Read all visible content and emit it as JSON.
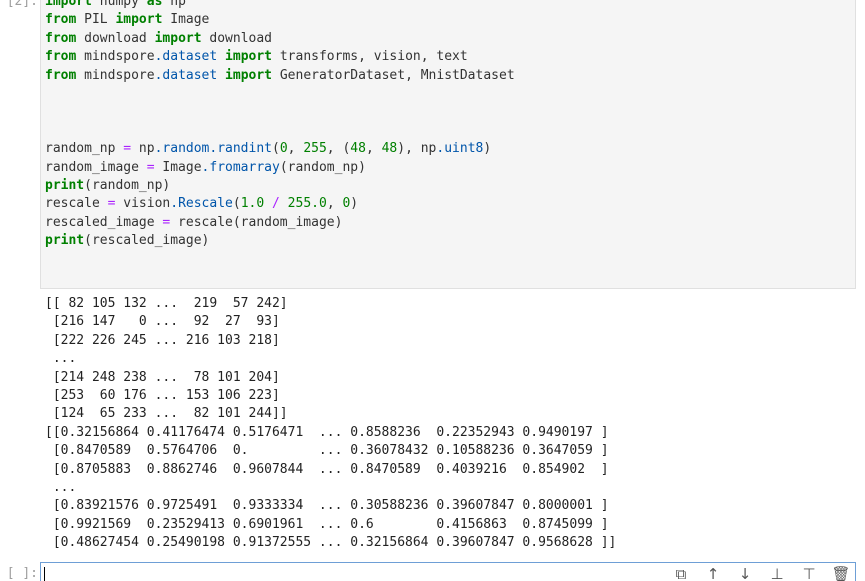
{
  "cell_top": {
    "prompt": "[2]:",
    "code_lines": [
      [
        {
          "t": "kw",
          "v": "import"
        },
        {
          "t": "p",
          "v": " numpy "
        },
        {
          "t": "kw",
          "v": "as"
        },
        {
          "t": "p",
          "v": " np"
        }
      ],
      [
        {
          "t": "kw",
          "v": "from"
        },
        {
          "t": "p",
          "v": " PIL "
        },
        {
          "t": "kw",
          "v": "import"
        },
        {
          "t": "p",
          "v": " Image"
        }
      ],
      [
        {
          "t": "kw",
          "v": "from"
        },
        {
          "t": "p",
          "v": " download "
        },
        {
          "t": "kw",
          "v": "import"
        },
        {
          "t": "p",
          "v": " download"
        }
      ],
      [
        {
          "t": "kw",
          "v": "from"
        },
        {
          "t": "p",
          "v": " mindspore"
        },
        {
          "t": "attr",
          "v": ".dataset"
        },
        {
          "t": "p",
          "v": " "
        },
        {
          "t": "kw",
          "v": "import"
        },
        {
          "t": "p",
          "v": " transforms, vision, text"
        }
      ],
      [
        {
          "t": "kw",
          "v": "from"
        },
        {
          "t": "p",
          "v": " mindspore"
        },
        {
          "t": "attr",
          "v": ".dataset"
        },
        {
          "t": "p",
          "v": " "
        },
        {
          "t": "kw",
          "v": "import"
        },
        {
          "t": "p",
          "v": " GeneratorDataset, MnistDataset"
        }
      ],
      [],
      [],
      [],
      [
        {
          "t": "p",
          "v": "random_np "
        },
        {
          "t": "op",
          "v": "="
        },
        {
          "t": "p",
          "v": " np"
        },
        {
          "t": "attr",
          "v": ".random.randint"
        },
        {
          "t": "p",
          "v": "("
        },
        {
          "t": "num",
          "v": "0"
        },
        {
          "t": "p",
          "v": ", "
        },
        {
          "t": "num",
          "v": "255"
        },
        {
          "t": "p",
          "v": ", ("
        },
        {
          "t": "num",
          "v": "48"
        },
        {
          "t": "p",
          "v": ", "
        },
        {
          "t": "num",
          "v": "48"
        },
        {
          "t": "p",
          "v": "), np"
        },
        {
          "t": "attr",
          "v": ".uint8"
        },
        {
          "t": "p",
          "v": ")"
        }
      ],
      [
        {
          "t": "p",
          "v": "random_image "
        },
        {
          "t": "op",
          "v": "="
        },
        {
          "t": "p",
          "v": " Image"
        },
        {
          "t": "attr",
          "v": ".fromarray"
        },
        {
          "t": "p",
          "v": "(random_np)"
        }
      ],
      [
        {
          "t": "kw",
          "v": "print"
        },
        {
          "t": "p",
          "v": "(random_np)"
        }
      ],
      [
        {
          "t": "p",
          "v": "rescale "
        },
        {
          "t": "op",
          "v": "="
        },
        {
          "t": "p",
          "v": " vision"
        },
        {
          "t": "attr",
          "v": ".Rescale"
        },
        {
          "t": "p",
          "v": "("
        },
        {
          "t": "num",
          "v": "1.0"
        },
        {
          "t": "p",
          "v": " "
        },
        {
          "t": "op",
          "v": "/"
        },
        {
          "t": "p",
          "v": " "
        },
        {
          "t": "num",
          "v": "255.0"
        },
        {
          "t": "p",
          "v": ", "
        },
        {
          "t": "num",
          "v": "0"
        },
        {
          "t": "p",
          "v": ")"
        }
      ],
      [
        {
          "t": "p",
          "v": "rescaled_image "
        },
        {
          "t": "op",
          "v": "="
        },
        {
          "t": "p",
          "v": " rescale(random_image)"
        }
      ],
      [
        {
          "t": "kw",
          "v": "print"
        },
        {
          "t": "p",
          "v": "(rescaled_image)"
        }
      ]
    ],
    "output_lines": [
      "[[ 82 105 132 ...  219  57 242]",
      " [216 147   0 ...  92  27  93]",
      " [222 226 245 ... 216 103 218]",
      " ...",
      " [214 248 238 ...  78 101 204]",
      " [253  60 176 ... 153 106 223]",
      " [124  65 233 ...  82 101 244]]",
      "[[0.32156864 0.41176474 0.5176471  ... 0.8588236  0.22352943 0.9490197 ]",
      " [0.8470589  0.5764706  0.         ... 0.36078432 0.10588236 0.3647059 ]",
      " [0.8705883  0.8862746  0.9607844  ... 0.8470589  0.4039216  0.854902  ]",
      " ...",
      " [0.83921576 0.9725491  0.9333334  ... 0.30588236 0.39607847 0.8000001 ]",
      " [0.9921569  0.23529413 0.6901961  ... 0.6        0.4156863  0.8745099 ]",
      " [0.48627454 0.25490198 0.91372555 ... 0.32156864 0.39607847 0.9568628 ]]"
    ]
  },
  "cell_new": {
    "prompt": "[ ]:",
    "toolbar": [
      {
        "name": "copy-icon",
        "glyph": "⧉"
      },
      {
        "name": "move-up-icon",
        "glyph": "↑"
      },
      {
        "name": "move-down-icon",
        "glyph": "↓"
      },
      {
        "name": "insert-above-icon",
        "glyph": "⊥"
      },
      {
        "name": "insert-below-icon",
        "glyph": "⊤"
      },
      {
        "name": "delete-icon",
        "glyph": "🗑"
      }
    ]
  }
}
